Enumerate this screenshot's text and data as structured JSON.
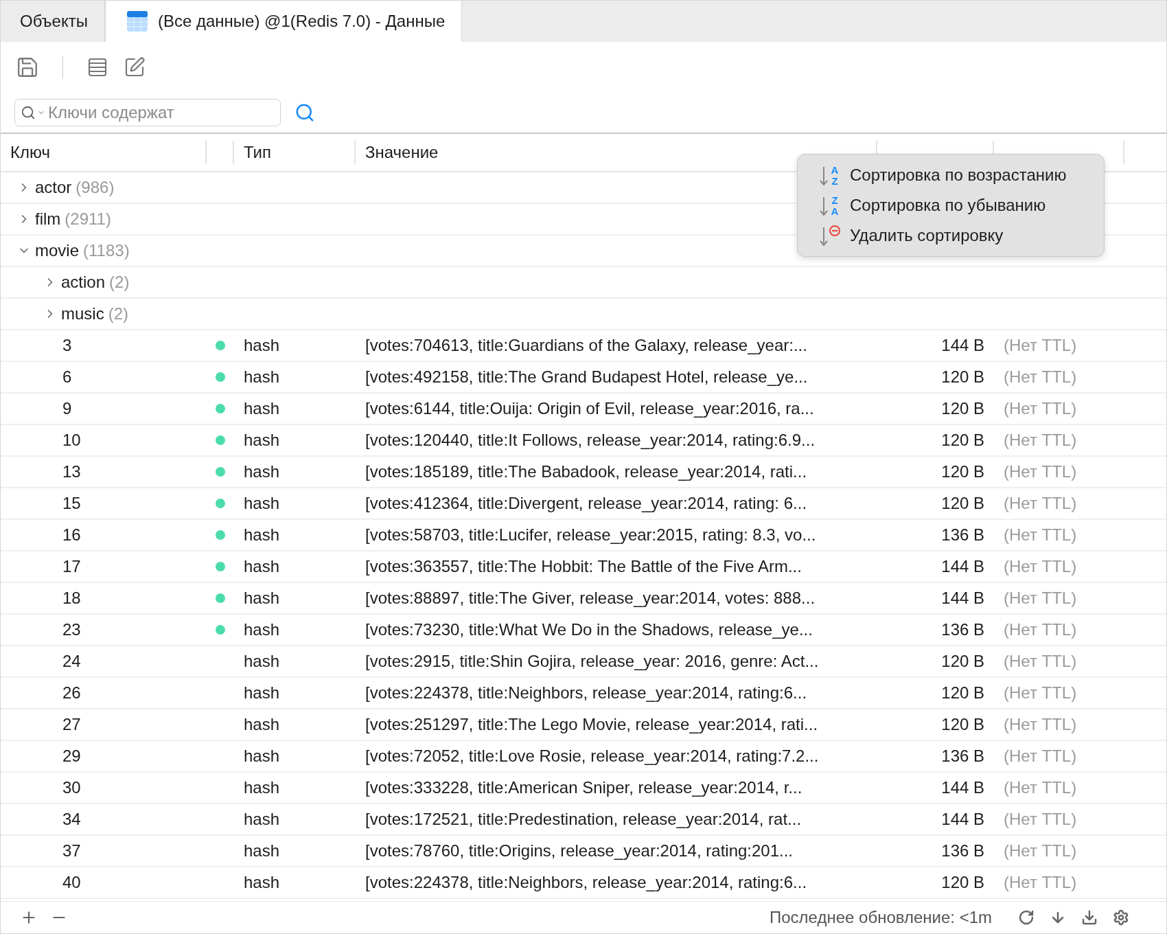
{
  "tabs": [
    {
      "label": "Объекты",
      "selected": false,
      "kind": "plain"
    },
    {
      "label": "(Все данные) @1(Redis 7.0) - Данные",
      "selected": true,
      "kind": "table"
    }
  ],
  "search": {
    "placeholder": "Ключи содержат"
  },
  "table": {
    "columns": [
      "Ключ",
      "Тип",
      "Значение"
    ],
    "rows": [
      {
        "kind": "folder",
        "name": "actor",
        "count": "(986)",
        "expanded": false
      },
      {
        "kind": "folder",
        "name": "film",
        "count": "(2911)",
        "expanded": false
      },
      {
        "kind": "folder",
        "name": "movie",
        "count": "(1183)",
        "expanded": true,
        "children": [
          {
            "kind": "folder",
            "name": "action",
            "count": "(2)",
            "expanded": false
          },
          {
            "kind": "folder",
            "name": "music",
            "count": "(2)",
            "expanded": false
          },
          {
            "kind": "key",
            "name": "3",
            "marked": true,
            "type": "hash",
            "value": "[votes:704613, title:Guardians of the Galaxy, release_year:...",
            "size": "144 B",
            "ttl": "(Нет TTL)"
          },
          {
            "kind": "key",
            "name": "6",
            "marked": true,
            "type": "hash",
            "value": "[votes:492158, title:The Grand Budapest Hotel, release_ye...",
            "size": "120 B",
            "ttl": "(Нет TTL)"
          },
          {
            "kind": "key",
            "name": "9",
            "marked": true,
            "type": "hash",
            "value": "[votes:6144, title:Ouija: Origin of Evil, release_year:2016, ra...",
            "size": "120 B",
            "ttl": "(Нет TTL)"
          },
          {
            "kind": "key",
            "name": "10",
            "marked": true,
            "type": "hash",
            "value": "[votes:120440, title:It Follows, release_year:2014, rating:6.9...",
            "size": "120 B",
            "ttl": "(Нет TTL)"
          },
          {
            "kind": "key",
            "name": "13",
            "marked": true,
            "type": "hash",
            "value": "[votes:185189, title:The Babadook, release_year:2014, rati...",
            "size": "120 B",
            "ttl": "(Нет TTL)"
          },
          {
            "kind": "key",
            "name": "15",
            "marked": true,
            "type": "hash",
            "value": "[votes:412364, title:Divergent, release_year:2014, rating: 6...",
            "size": "120 B",
            "ttl": "(Нет TTL)"
          },
          {
            "kind": "key",
            "name": "16",
            "marked": true,
            "type": "hash",
            "value": "[votes:58703, title:Lucifer, release_year:2015, rating: 8.3, vo...",
            "size": "136 B",
            "ttl": "(Нет TTL)"
          },
          {
            "kind": "key",
            "name": "17",
            "marked": true,
            "type": "hash",
            "value": "[votes:363557, title:The Hobbit: The Battle of the Five Arm...",
            "size": "144 B",
            "ttl": "(Нет TTL)"
          },
          {
            "kind": "key",
            "name": "18",
            "marked": true,
            "type": "hash",
            "value": "[votes:88897, title:The Giver, release_year:2014, votes: 888...",
            "size": "144 B",
            "ttl": "(Нет TTL)"
          },
          {
            "kind": "key",
            "name": "23",
            "marked": true,
            "type": "hash",
            "value": "[votes:73230, title:What We Do in the Shadows, release_ye...",
            "size": "136 B",
            "ttl": "(Нет TTL)"
          },
          {
            "kind": "key",
            "name": "24",
            "marked": false,
            "type": "hash",
            "value": "[votes:2915, title:Shin Gojira, release_year: 2016, genre: Act...",
            "size": "120 B",
            "ttl": "(Нет TTL)"
          },
          {
            "kind": "key",
            "name": "26",
            "marked": false,
            "type": "hash",
            "value": "[votes:224378, title:Neighbors, release_year:2014, rating:6...",
            "size": "120 B",
            "ttl": "(Нет TTL)"
          },
          {
            "kind": "key",
            "name": "27",
            "marked": false,
            "type": "hash",
            "value": "[votes:251297, title:The Lego Movie, release_year:2014, rati...",
            "size": "120 B",
            "ttl": "(Нет TTL)"
          },
          {
            "kind": "key",
            "name": "29",
            "marked": false,
            "type": "hash",
            "value": "[votes:72052, title:Love Rosie, release_year:2014, rating:7.2...",
            "size": "136 B",
            "ttl": "(Нет TTL)"
          },
          {
            "kind": "key",
            "name": "30",
            "marked": false,
            "type": "hash",
            "value": "[votes:333228, title:American Sniper, release_year:2014, r...",
            "size": "144 B",
            "ttl": "(Нет TTL)"
          },
          {
            "kind": "key",
            "name": "34",
            "marked": false,
            "type": "hash",
            "value": "[votes:172521, title:Predestination, release_year:2014, rat...",
            "size": "144 B",
            "ttl": "(Нет TTL)"
          },
          {
            "kind": "key",
            "name": "37",
            "marked": false,
            "type": "hash",
            "value": "[votes:78760, title:Origins, release_year:2014, rating:201...",
            "size": "136 B",
            "ttl": "(Нет TTL)"
          },
          {
            "kind": "key",
            "name": "40",
            "marked": false,
            "type": "hash",
            "value": "[votes:224378, title:Neighbors, release_year:2014, rating:6...",
            "size": "120 B",
            "ttl": "(Нет TTL)"
          }
        ]
      }
    ]
  },
  "sort_menu": [
    {
      "kind": "asc",
      "label": "Сортировка по возрастанию",
      "icon_top": "A",
      "icon_bottom": "Z"
    },
    {
      "kind": "desc",
      "label": "Сортировка по убыванию",
      "icon_top": "Z",
      "icon_bottom": "A"
    },
    {
      "kind": "clear",
      "label": "Удалить сортировку"
    }
  ],
  "status_bar": {
    "text": "Последнее обновление: <1m"
  }
}
